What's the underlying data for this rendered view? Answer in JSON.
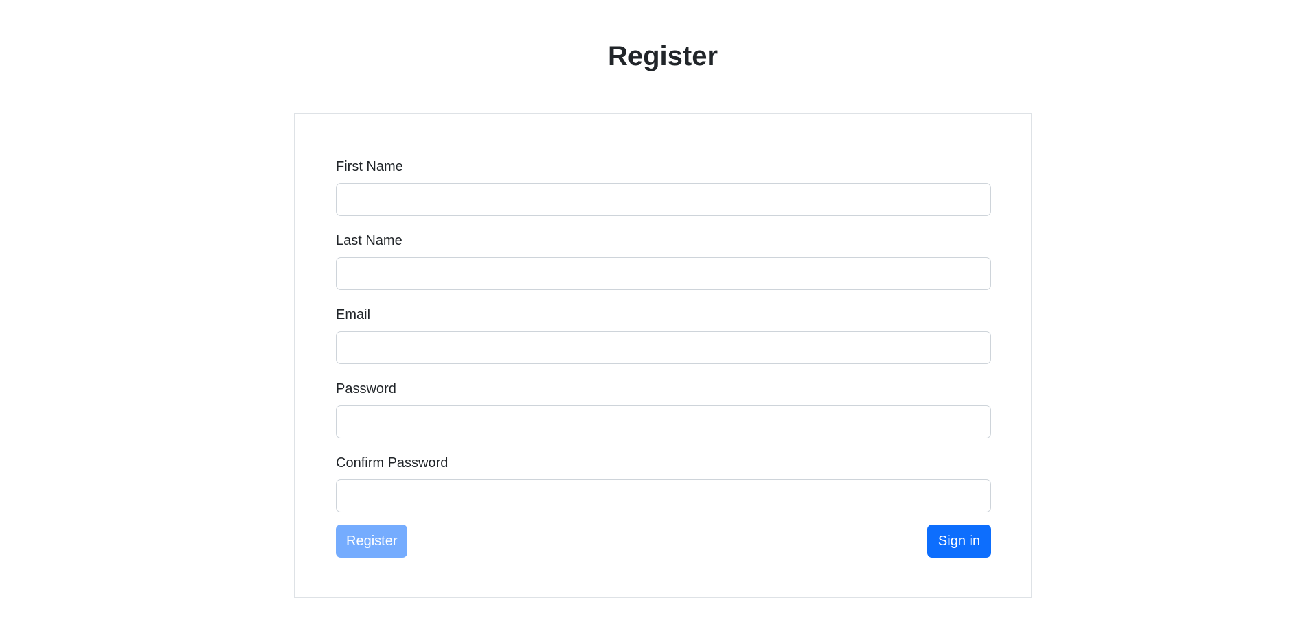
{
  "page": {
    "title": "Register"
  },
  "form": {
    "fields": [
      {
        "label": "First Name",
        "value": "",
        "placeholder": ""
      },
      {
        "label": "Last Name",
        "value": "",
        "placeholder": ""
      },
      {
        "label": "Email",
        "value": "",
        "placeholder": ""
      },
      {
        "label": "Password",
        "value": "",
        "placeholder": ""
      },
      {
        "label": "Confirm Password",
        "value": "",
        "placeholder": ""
      }
    ],
    "register_label": "Register",
    "signin_label": "Sign in"
  },
  "colors": {
    "primary": "#0d6efd",
    "primary_disabled": "#6ea8fe",
    "text": "#212529",
    "border": "#dee2e6"
  }
}
